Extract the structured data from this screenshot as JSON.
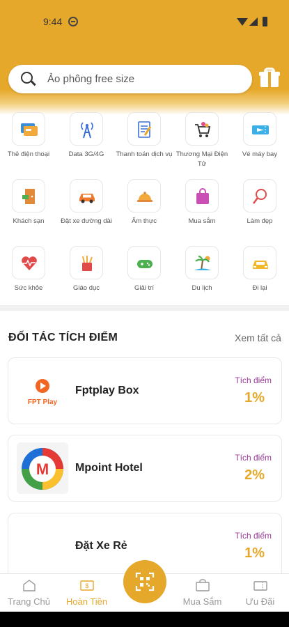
{
  "status_bar": {
    "time": "9:44"
  },
  "search": {
    "placeholder": "Ảo phông free size"
  },
  "categories": [
    {
      "label": "Thẻ điện thoại",
      "icon": "phone-card-icon"
    },
    {
      "label": "Data 3G/4G",
      "icon": "antenna-icon"
    },
    {
      "label": "Thanh toán dịch vụ",
      "icon": "bill-payment-icon"
    },
    {
      "label": "Thương Mại Điện Tử",
      "icon": "ecommerce-cart-icon"
    },
    {
      "label": "Vé máy bay",
      "icon": "plane-ticket-icon"
    },
    {
      "label": "Khách sạn",
      "icon": "hotel-door-icon"
    },
    {
      "label": "Đặt xe đường dài",
      "icon": "car-icon"
    },
    {
      "label": "Ẩm thực",
      "icon": "food-cloche-icon"
    },
    {
      "label": "Mua sắm",
      "icon": "shopping-bag-icon"
    },
    {
      "label": "Làm đẹp",
      "icon": "mirror-icon"
    },
    {
      "label": "Sức khỏe",
      "icon": "heart-pulse-icon"
    },
    {
      "label": "Giáo dục",
      "icon": "pencil-cup-icon"
    },
    {
      "label": "Giải trí",
      "icon": "gamepad-icon"
    },
    {
      "label": "Du lịch",
      "icon": "beach-icon"
    },
    {
      "label": "Đi lại",
      "icon": "taxi-icon"
    }
  ],
  "partners": {
    "title": "ĐỐI TÁC TÍCH ĐIỂM",
    "see_all": "Xem tất cả",
    "items": [
      {
        "name": "Fptplay Box",
        "logo_text": "FPT Play",
        "earn_label": "Tích điểm",
        "percent": "1%"
      },
      {
        "name": "Mpoint Hotel",
        "logo_text": "M",
        "earn_label": "Tích điểm",
        "percent": "2%"
      },
      {
        "name": "Đặt Xe Rẻ",
        "logo_text": "",
        "earn_label": "Tích điểm",
        "percent": "1%"
      }
    ]
  },
  "bottom_nav": [
    {
      "label": "Trang Chủ",
      "icon": "home-icon",
      "active": false
    },
    {
      "label": "Hoàn Tiền",
      "icon": "cashback-icon",
      "active": true
    },
    {
      "label": "Mua Sắm",
      "icon": "shopping-icon",
      "active": false
    },
    {
      "label": "Ưu Đãi",
      "icon": "voucher-icon",
      "active": false
    }
  ],
  "colors": {
    "brand": "#e6a82b",
    "accent_purple": "#9c3c9a"
  }
}
